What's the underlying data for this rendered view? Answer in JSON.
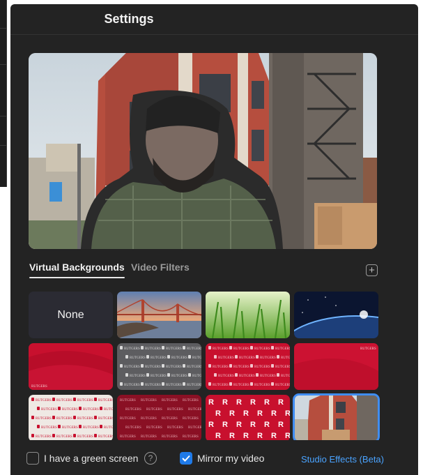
{
  "dialog": {
    "title": "Settings"
  },
  "tabs": [
    {
      "label": "Virtual Backgrounds",
      "active": true
    },
    {
      "label": "Video Filters",
      "active": false
    }
  ],
  "add_icon": "plus-icon",
  "backgrounds": {
    "none_label": "None",
    "items": [
      {
        "name": "none"
      },
      {
        "name": "golden-gate-bridge"
      },
      {
        "name": "grass"
      },
      {
        "name": "earth-from-space"
      },
      {
        "name": "red-wave-logo"
      },
      {
        "name": "gray-logo-pattern"
      },
      {
        "name": "red-logo-pattern"
      },
      {
        "name": "red-gradient-logo"
      },
      {
        "name": "white-logo-pattern"
      },
      {
        "name": "dark-red-logo-pattern"
      },
      {
        "name": "red-r-pattern"
      },
      {
        "name": "city-building",
        "selected": true
      }
    ],
    "logo_text": "RUTGERS",
    "r_letter": "R"
  },
  "options": {
    "green_screen_label": "I have a green screen",
    "green_screen_checked": false,
    "help_icon": "question-mark",
    "mirror_label": "Mirror my video",
    "mirror_checked": true,
    "studio_effects_label": "Studio Effects (Beta)"
  },
  "colors": {
    "accent": "#1f7ae8",
    "link": "#4aa3ff",
    "dialog_bg": "#232323",
    "selected_outline": "#3f8df2"
  }
}
